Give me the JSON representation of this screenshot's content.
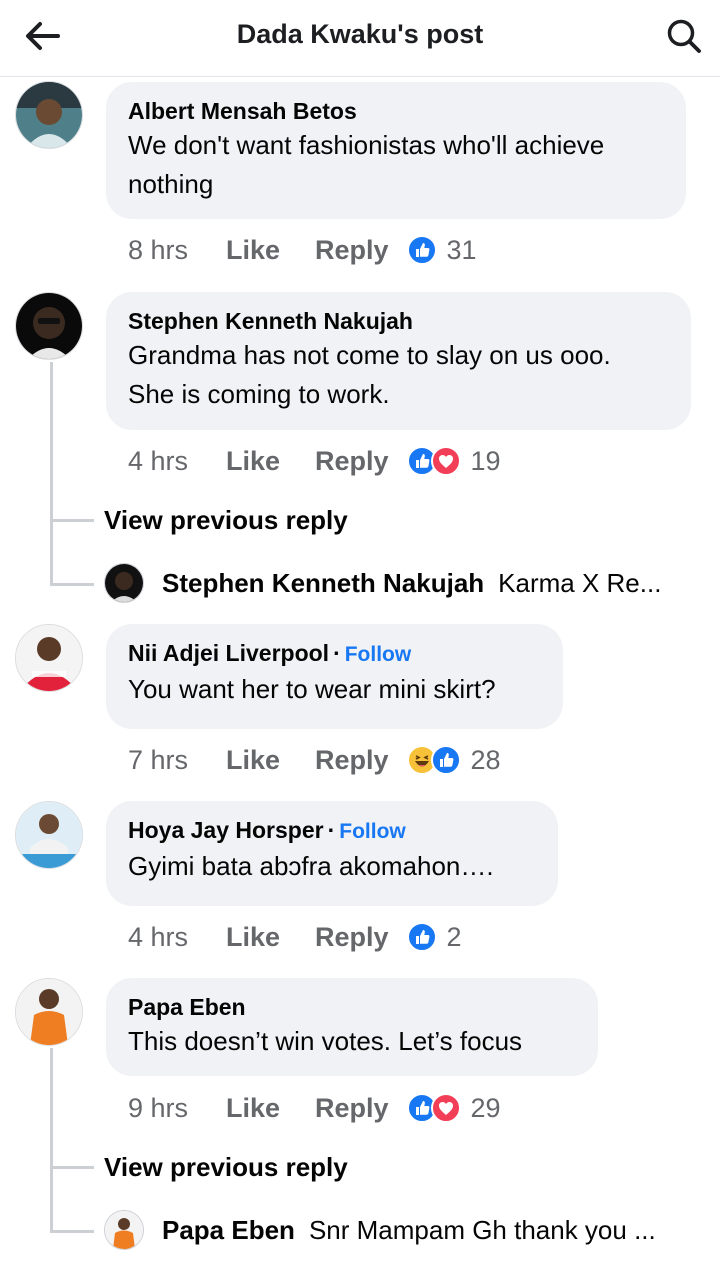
{
  "header": {
    "title": "Dada Kwaku's post",
    "back_icon": "arrow-left-icon",
    "search_icon": "search-icon"
  },
  "labels": {
    "like": "Like",
    "reply": "Reply",
    "follow": "Follow",
    "view_previous": "View previous reply"
  },
  "comments": [
    {
      "author": "Albert Mensah Betos",
      "text_lines": [
        "We don't want fashionistas who'll achieve",
        "nothing"
      ],
      "time": "8 hrs",
      "reactions": [
        "like"
      ],
      "count": "31"
    },
    {
      "author": "Stephen Kenneth Nakujah",
      "text_lines": [
        "Grandma has not come to slay on us ooo.",
        "She is coming to work."
      ],
      "time": "4 hrs",
      "reactions": [
        "like",
        "love"
      ],
      "count": "19",
      "reply_preview": {
        "author": "Stephen Kenneth Nakujah",
        "text": "Karma X Re..."
      }
    },
    {
      "author": "Nii Adjei Liverpool",
      "follow": true,
      "text_lines": [
        "You want her to wear mini skirt?"
      ],
      "time": "7 hrs",
      "reactions": [
        "haha",
        "like"
      ],
      "count": "28"
    },
    {
      "author": "Hoya Jay Horsper",
      "follow": true,
      "text_lines": [
        "Gyimi bata abɔfra akomahon…."
      ],
      "time": "4 hrs",
      "reactions": [
        "like"
      ],
      "count": "2"
    },
    {
      "author": "Papa Eben",
      "text_lines": [
        "This doesn’t win votes. Let’s focus"
      ],
      "time": "9 hrs",
      "reactions": [
        "like",
        "love"
      ],
      "count": "29",
      "reply_preview": {
        "author": "Papa Eben",
        "text": "Snr Mampam Gh thank you ..."
      }
    }
  ],
  "colors": {
    "accent": "#1877f2",
    "love": "#f33e58",
    "bubble": "#f0f2f5",
    "meta": "#65676b"
  }
}
